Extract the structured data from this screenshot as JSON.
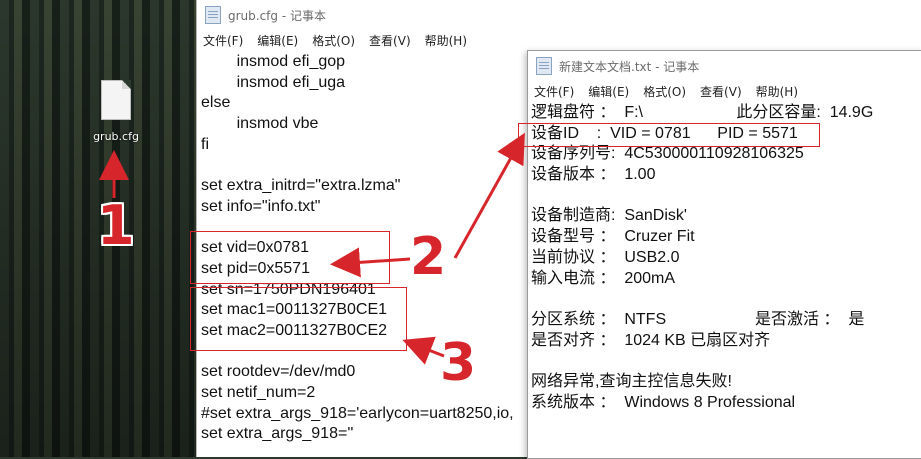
{
  "desktop": {
    "file_icon_label": "grub.cfg"
  },
  "notepad_main": {
    "title": "grub.cfg - 记事本",
    "menu": [
      "文件(F)",
      "编辑(E)",
      "格式(O)",
      "查看(V)",
      "帮助(H)"
    ],
    "lines": [
      "        insmod efi_gop",
      "        insmod efi_uga",
      "else",
      "        insmod vbe",
      "fi",
      "",
      "set extra_initrd=\"extra.lzma\"",
      "set info=\"info.txt\"",
      "",
      "set vid=0x0781",
      "set pid=0x5571",
      "set sn=1750PDN196401",
      "set mac1=0011327B0CE1",
      "set mac2=0011327B0CE2",
      "",
      "set rootdev=/dev/md0",
      "set netif_num=2",
      "#set extra_args_918='earlycon=uart8250,io,",
      "set extra_args_918=''"
    ]
  },
  "notepad_info": {
    "title": "新建文本文档.txt - 记事本",
    "menu": [
      "文件(F)",
      "编辑(E)",
      "格式(O)",
      "查看(V)",
      "帮助(H)"
    ],
    "lines": [
      "逻辑盘符 ：  F:\\                     此分区容量:  14.9G",
      "设备ID    :  VID = 0781      PID = 5571",
      "设备序列号:  4C530000110928106325",
      "设备版本 ：  1.00",
      "",
      "设备制造商:  SanDisk'",
      "设备型号 ：  Cruzer Fit",
      "当前协议 ：  USB2.0",
      "输入电流 ：  200mA",
      "",
      "分区系统 ：  NTFS                    是否激活 ：  是",
      "是否对齐 ：  1024 KB 已扇区对齐",
      "",
      "网络异常,查询主控信息失败!",
      "系统版本 ：  Windows 8 Professional"
    ]
  },
  "annotations": {
    "n1": "1",
    "n2": "2",
    "n3": "3"
  },
  "colors": {
    "accent_red": "#d7262b"
  }
}
